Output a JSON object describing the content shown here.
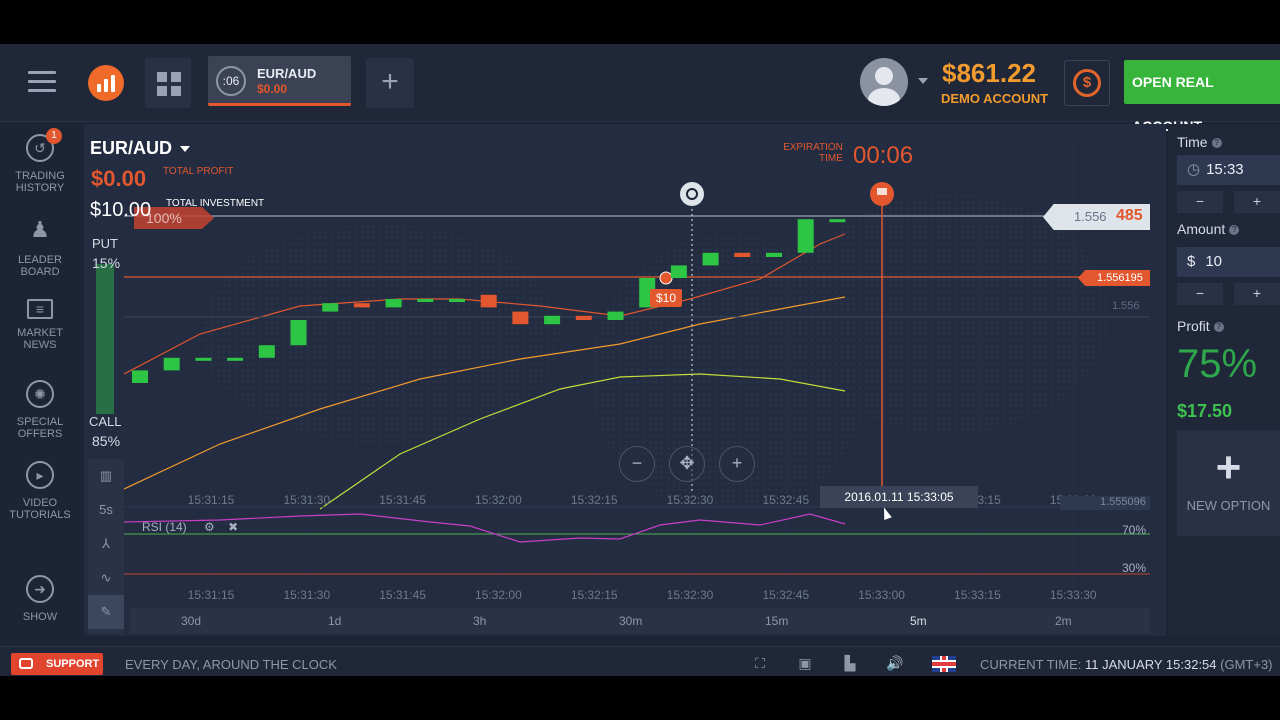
{
  "topbar": {
    "asset_tab": {
      "timer": ":06",
      "name": "EUR/AUD",
      "profit": "$0.00"
    },
    "add_tab": "+",
    "balance": "$861.22",
    "account_type": "DEMO ACCOUNT",
    "open_account": "OPEN REAL ACCOUNT"
  },
  "sidebar": {
    "badge": "1",
    "items": [
      {
        "label": "TRADING HISTORY",
        "icon": "history-icon"
      },
      {
        "label": "LEADER BOARD",
        "icon": "leaderboard-icon"
      },
      {
        "label": "MARKET NEWS",
        "icon": "news-icon"
      },
      {
        "label": "SPECIAL OFFERS",
        "icon": "offers-icon"
      },
      {
        "label": "VIDEO TUTORIALS",
        "icon": "play-icon"
      },
      {
        "label": "SHOW",
        "icon": "arrow-right-icon"
      }
    ]
  },
  "chart_header": {
    "asset": "EUR/AUD",
    "total_profit_value": "$0.00",
    "total_profit_label": "TOTAL PROFIT",
    "total_investment_value": "$10.00",
    "total_investment_label": "TOTAL INVESTMENT",
    "percent_flag": "100%",
    "put_label": "PUT",
    "put_percent": "15%",
    "call_label": "CALL",
    "call_percent": "85%",
    "expiration_label_1": "EXPIRATION",
    "expiration_label_2": "TIME",
    "expiration_value": "00:06"
  },
  "tools": [
    "5s"
  ],
  "chart_data": {
    "type": "candlestick",
    "current_price": "1.556485",
    "current_price_main": "1.556",
    "current_price_accent": "485",
    "strike_price": "1.556195",
    "price_level": "1.556",
    "low_price": "1.555096",
    "bet_amount": "$10",
    "hover_date": "2016.01.11 15:33:05",
    "x_ticks": [
      "15:31:15",
      "15:31:30",
      "15:31:45",
      "15:32:00",
      "15:32:15",
      "15:32:30",
      "15:32:45",
      "15:33:00",
      "15:33:15",
      "15:33:30"
    ],
    "indicator": {
      "name": "RSI (14)",
      "upper": "70%",
      "lower": "30%"
    },
    "candles": [
      {
        "x": 0.0,
        "o": 1.5535,
        "c": 1.5538
      },
      {
        "x": 1.0,
        "o": 1.5538,
        "c": 1.5541
      },
      {
        "x": 2.0,
        "o": 1.5541,
        "c": 1.5541
      },
      {
        "x": 3.0,
        "o": 1.5541,
        "c": 1.5541
      },
      {
        "x": 4.0,
        "o": 1.5541,
        "c": 1.5544
      },
      {
        "x": 5.0,
        "o": 1.5544,
        "c": 1.555
      },
      {
        "x": 6.0,
        "o": 1.5552,
        "c": 1.5554
      },
      {
        "x": 7.0,
        "o": 1.5554,
        "c": 1.5553
      },
      {
        "x": 8.0,
        "o": 1.5553,
        "c": 1.5555
      },
      {
        "x": 9.0,
        "o": 1.5555,
        "c": 1.5555
      },
      {
        "x": 10.0,
        "o": 1.5555,
        "c": 1.5555
      },
      {
        "x": 11.0,
        "o": 1.5556,
        "c": 1.5553
      },
      {
        "x": 12.0,
        "o": 1.5552,
        "c": 1.5549
      },
      {
        "x": 13.0,
        "o": 1.5549,
        "c": 1.5551
      },
      {
        "x": 14.0,
        "o": 1.5551,
        "c": 1.555
      },
      {
        "x": 15.0,
        "o": 1.555,
        "c": 1.5552
      },
      {
        "x": 16.0,
        "o": 1.5553,
        "c": 1.556
      },
      {
        "x": 17.0,
        "o": 1.556,
        "c": 1.5563
      },
      {
        "x": 18.0,
        "o": 1.5563,
        "c": 1.5566
      },
      {
        "x": 19.0,
        "o": 1.5566,
        "c": 1.5565
      },
      {
        "x": 20.0,
        "o": 1.5565,
        "c": 1.5566
      },
      {
        "x": 21.0,
        "o": 1.5566,
        "c": 1.5574
      },
      {
        "x": 22.0,
        "o": 1.5574,
        "c": 1.5574
      }
    ]
  },
  "timeframes": [
    "30d",
    "1d",
    "3h",
    "30m",
    "15m",
    "5m",
    "2m"
  ],
  "timeframe_active": "5m",
  "right_panel": {
    "time_label": "Time",
    "time_value": "15:33",
    "amount_label": "Amount",
    "amount_currency": "$",
    "amount_value": "10",
    "profit_label": "Profit",
    "profit_percent": "75%",
    "profit_value": "$17.50",
    "new_option": "NEW OPTION",
    "minus": "−",
    "plus": "+"
  },
  "bottom": {
    "support": "SUPPORT",
    "tagline": "EVERY DAY, AROUND THE CLOCK",
    "current_time_label": "CURRENT TIME:",
    "current_time_value": "11 JANUARY 15:32:54",
    "timezone": "(GMT+3)"
  },
  "colors": {
    "accent": "#e2572e",
    "green": "#3ec24f",
    "balance": "#f29b2e",
    "bg": "#232c40"
  }
}
